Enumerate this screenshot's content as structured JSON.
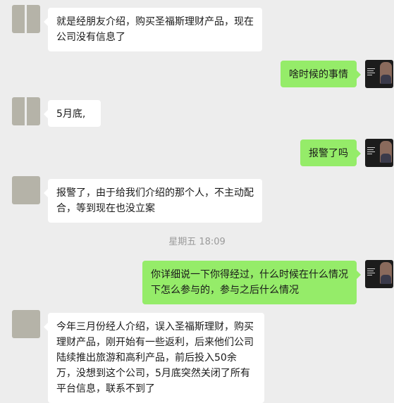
{
  "chat": {
    "messages": [
      {
        "sender": "other",
        "text": "就是经朋友介绍，购买圣福斯理财产品，现在公司没有信息了"
      },
      {
        "sender": "me",
        "text": "啥时候的事情"
      },
      {
        "sender": "other",
        "text": "5月底,"
      },
      {
        "sender": "me",
        "text": "报警了吗"
      },
      {
        "sender": "other",
        "text": "报警了，由于给我们介绍的那个人，不主动配合，等到现在也没立案"
      },
      {
        "sender": "me",
        "text": "你详细说一下你得经过，什么时候在什么情况下怎么参与的，参与之后什么情况"
      },
      {
        "sender": "other",
        "text": "今年三月份经人介绍，误入圣福斯理财，购买理财产品，刚开始有一些返利，后来他们公司陆续推出旅游和高利产品，前后投入50余万，没想到这个公司，5月底突然关闭了所有平台信息，联系不到了"
      }
    ],
    "timestamp": "星期五 18:09"
  },
  "colors": {
    "background": "#ededed",
    "incoming_bubble": "#ffffff",
    "outgoing_bubble": "#95ec69",
    "timestamp_text": "#9a9a9a"
  }
}
